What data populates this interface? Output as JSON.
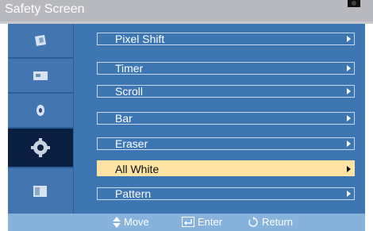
{
  "title": "Safety Screen",
  "menu_items": [
    {
      "label": "Pixel Shift"
    },
    {
      "label": "Timer"
    },
    {
      "label": "Scroll"
    },
    {
      "label": "Bar"
    },
    {
      "label": "Eraser"
    },
    {
      "label": "All White"
    },
    {
      "label": "Pattern"
    }
  ],
  "selected_item": "All White",
  "sidebar_icons": [
    "picture-icon",
    "screen-icon",
    "sound-icon",
    "setup-icon",
    "multi-control-icon"
  ],
  "footer": {
    "move": "Move",
    "enter": "Enter",
    "return": "Return"
  },
  "colors": {
    "panel": "#3e75b3",
    "highlight": "#fde3a4",
    "footer": "#86b2dc",
    "title_bar": "#b7b9bf"
  }
}
